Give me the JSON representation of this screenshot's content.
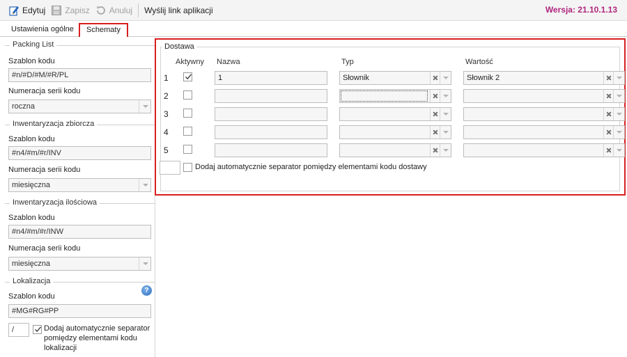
{
  "toolbar": {
    "edit_label": "Edytuj",
    "save_label": "Zapisz",
    "cancel_label": "Anuluj",
    "send_link_label": "Wyślij link aplikacji",
    "version": "Wersja: 21.10.1.13"
  },
  "tabs": [
    {
      "label": "Ustawienia ogólne",
      "active": false
    },
    {
      "label": "Schematy",
      "active": true
    }
  ],
  "left": {
    "packing_list": {
      "title": "Packing List",
      "code_label": "Szablon kodu",
      "code_value": "#n/#D/#M/#R/PL",
      "numbering_label": "Numeracja serii kodu",
      "numbering_value": "roczna"
    },
    "inventory_collective": {
      "title": "Inwentaryzacja zbiorcza",
      "code_label": "Szablon kodu",
      "code_value": "#n4/#m/#r/INV",
      "numbering_label": "Numeracja serii kodu",
      "numbering_value": "miesięczna"
    },
    "inventory_quantity": {
      "title": "Inwentaryzacja ilościowa",
      "code_label": "Szablon kodu",
      "code_value": "#n4/#m/#r/INW",
      "numbering_label": "Numeracja serii kodu",
      "numbering_value": "miesięczna"
    },
    "location": {
      "title": "Lokalizacja",
      "code_label": "Szablon kodu",
      "code_value": "#MG#RG#PP",
      "separator_value": "/",
      "separator_checked": true,
      "separator_label_1": "Dodaj automatycznie separator",
      "separator_label_2": "pomiędzy elementami kodu",
      "separator_label_3": "lokalizacji"
    }
  },
  "delivery": {
    "title": "Dostawa",
    "col_active": "Aktywny",
    "col_name": "Nazwa",
    "col_type": "Typ",
    "col_value": "Wartość",
    "rows": [
      {
        "num": "1",
        "active": true,
        "name": "1",
        "type": "Słownik",
        "value": "Słownik 2"
      },
      {
        "num": "2",
        "active": false,
        "name": "",
        "type": "",
        "value": ""
      },
      {
        "num": "3",
        "active": false,
        "name": "",
        "type": "",
        "value": ""
      },
      {
        "num": "4",
        "active": false,
        "name": "",
        "type": "",
        "value": ""
      },
      {
        "num": "5",
        "active": false,
        "name": "",
        "type": "",
        "value": ""
      }
    ],
    "separator_value": "",
    "separator_checked": false,
    "separator_label": "Dodaj automatycznie separator pomiędzy elementami kodu dostawy"
  },
  "colors": {
    "version": "#b0267e",
    "highlight_border": "#d81e1e"
  }
}
